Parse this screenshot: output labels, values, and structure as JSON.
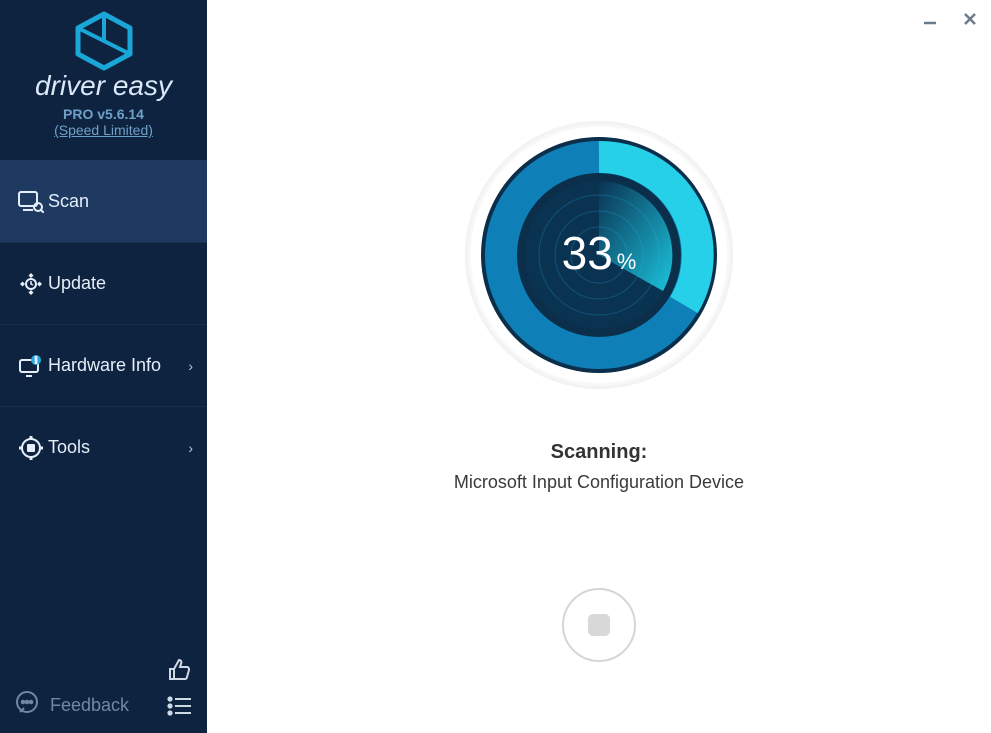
{
  "app": {
    "brand": "driver easy",
    "version": "PRO v5.6.14",
    "speed_limited": "(Speed Limited)"
  },
  "nav": {
    "scan": "Scan",
    "update": "Update",
    "hardware": "Hardware Info",
    "tools": "Tools"
  },
  "footer": {
    "feedback": "Feedback"
  },
  "scan": {
    "percent": "33",
    "percent_sign": "%",
    "label": "Scanning:",
    "device": "Microsoft Input Configuration Device"
  },
  "colors": {
    "sidebar": "#0e2340",
    "sidebar_active": "#1e3a61",
    "ring_outer": "#0f7fb8",
    "ring_inner_light": "#25d0e8",
    "ring_core": "#0b2e4a"
  }
}
